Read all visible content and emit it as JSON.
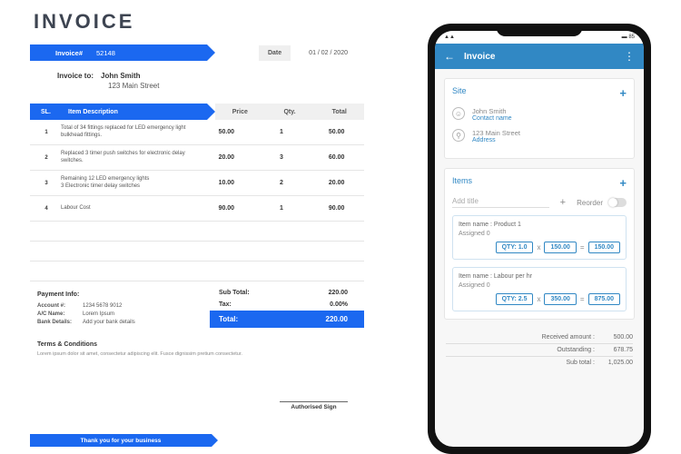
{
  "doc": {
    "title": "INVOICE",
    "inv_label": "Invoice#",
    "inv_no": "52148",
    "date_label": "Date",
    "date": "01 / 02 / 2020",
    "to_label": "Invoice to:",
    "to_name": "John Smith",
    "to_addr": "123 Main Street",
    "cols": {
      "sl": "SL.",
      "desc": "Item Description",
      "price": "Price",
      "qty": "Qty.",
      "total": "Total"
    },
    "rows": [
      {
        "sl": "1",
        "desc": "Total of 34 fittings replaced for LED emergency light bulkhead fittings.",
        "price": "50.00",
        "qty": "1",
        "total": "50.00"
      },
      {
        "sl": "2",
        "desc": "Replaced 3 timer push switches for electronic delay switches.",
        "price": "20.00",
        "qty": "3",
        "total": "60.00"
      },
      {
        "sl": "3",
        "desc": "Remaining 12 LED emergency lights\n3 Electronic timer delay switches",
        "price": "10.00",
        "qty": "2",
        "total": "20.00"
      },
      {
        "sl": "4",
        "desc": "Labour Cost",
        "price": "90.00",
        "qty": "1",
        "total": "90.00"
      }
    ],
    "subtotal_label": "Sub Total:",
    "subtotal": "220.00",
    "tax_label": "Tax:",
    "tax": "0.00%",
    "grand_label": "Total:",
    "grand": "220.00",
    "pay_title": "Payment Info:",
    "pay": [
      {
        "k": "Account #:",
        "v": "1234 5678 9012"
      },
      {
        "k": "A/C Name:",
        "v": "Lorem Ipsum"
      },
      {
        "k": "Bank Details:",
        "v": "Add your bank details"
      }
    ],
    "tc_title": "Terms & Conditions",
    "tc_body": "Lorem ipsum dolor sit amet, consectetur adipiscing elit. Fusce dignissim pretium consectetur.",
    "sign": "Authorised Sign",
    "thanks": "Thank you for your business"
  },
  "phone": {
    "status": {
      "signal": "▲▲",
      "batt": "85"
    },
    "title": "Invoice",
    "site": {
      "title": "Site",
      "r1": {
        "name": "John Smith",
        "lbl": "Contact name"
      },
      "r2": {
        "name": "123 Main Street",
        "lbl": "Address"
      }
    },
    "items": {
      "title": "Items",
      "add_placeholder": "Add title",
      "reorder": "Reorder",
      "list": [
        {
          "name": "Item name : Product 1",
          "assigned": "Assigned 0",
          "qty": "QTY: 1.0",
          "price": "150.00",
          "total": "150.00"
        },
        {
          "name": "Item name : Labour per hr",
          "assigned": "Assigned 0",
          "qty": "QTY: 2.5",
          "price": "350.00",
          "total": "875.00"
        }
      ]
    },
    "footer": {
      "received_k": "Received amount :",
      "received_v": "500.00",
      "out_k": "Outstanding :",
      "out_v": "678.75",
      "sub_k": "Sub total :",
      "sub_v": "1,025.00"
    }
  }
}
